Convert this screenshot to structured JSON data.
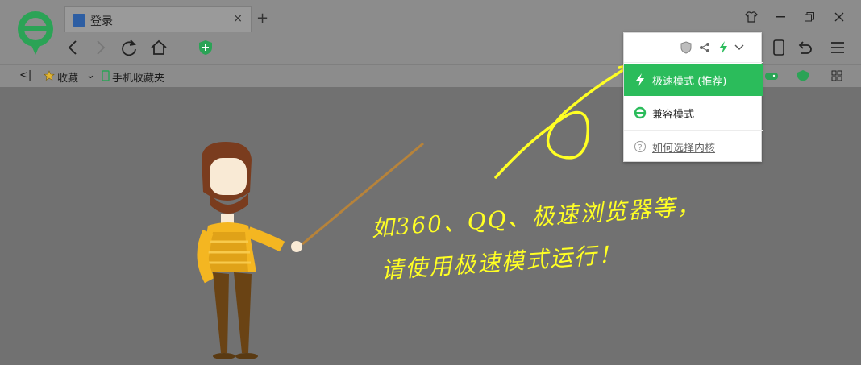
{
  "tab": {
    "title": "登录",
    "close": "×"
  },
  "new_tab": "+",
  "bookmarks": {
    "collapse": "<|",
    "favorites": "收藏",
    "favorites_arrow": "⌄",
    "mobile_favorites": "手机收藏夹"
  },
  "popup": {
    "active_option": "极速模式 (推荐)",
    "compat_option": "兼容模式",
    "help_option": "如何选择内核"
  },
  "handwriting": {
    "line1": "如360、QQ、极速浏览器等，",
    "line2": "请使用极速模式运行！"
  },
  "colors": {
    "accent": "#2bbc5b",
    "hand": "#ffff24",
    "overlay": "#717171"
  }
}
